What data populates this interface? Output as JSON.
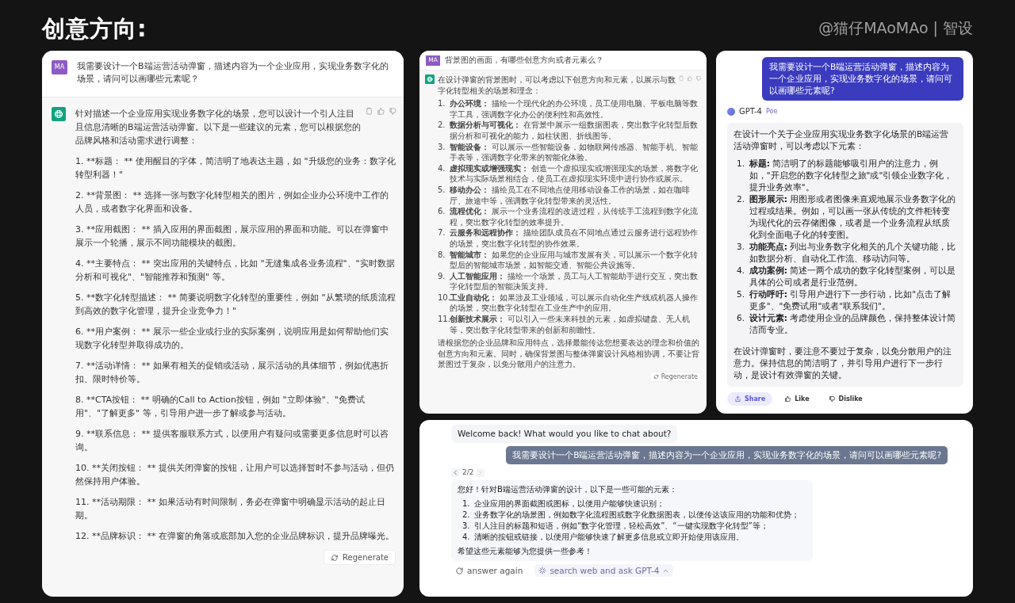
{
  "header": {
    "title": "创意方向:",
    "credit": "@猫仔MAoMAo | 智设"
  },
  "chatgpt_panel": {
    "user_avatar": "MA",
    "question": "我需要设计一个B端运营活动弹窗，描述内容为一个企业应用，实现业务数字化的场景，请问可以画哪些元素呢？",
    "answer_paragraphs": [
      "针对描述一个企业应用实现业务数字化的场景，您可以设计一个引人注目且信息清晰的B端运营活动弹窗。以下是一些建议的元素，您可以根据您的品牌风格和活动需求进行调整：",
      "1. **标题： ** 使用醒目的字体，简洁明了地表达主题，如 \"升级您的业务：数字化转型利器！\"",
      "2. **背景图： ** 选择一张与数字化转型相关的图片，例如企业办公环境中工作的人员，或者数字化界面和设备。",
      "3. **应用截图： ** 插入应用的界面截图，展示应用的界面和功能。可以在弹窗中展示一个轮播，展示不同功能模块的截图。",
      "4. **主要特点： ** 突出应用的关键特点，比如 \"无缝集成各业务流程\"、\"实时数据分析和可视化\"、\"智能推荐和预测\" 等。",
      "5. **数字化转型描述： ** 简要说明数字化转型的重要性，例如 \"从繁琐的纸质流程到高效的数字化管理，提升企业竞争力！\"",
      "6. **用户案例： ** 展示一些企业或行业的实际案例，说明应用是如何帮助他们实现数字化转型并取得成功的。",
      "7. **活动详情： ** 如果有相关的促销或活动，展示活动的具体细节，例如优惠折扣、限时特价等。",
      "8. **CTA按钮： ** 明确的Call to Action按钮，例如 \"立即体验\"、\"免费试用\"、\"了解更多\" 等，引导用户进一步了解或参与活动。",
      "9. **联系信息： ** 提供客服联系方式，以便用户有疑问或需要更多信息时可以咨询。",
      "10. **关闭按钮： ** 提供关闭弹窗的按钮，让用户可以选择暂时不参与活动，但仍然保持用户体验。",
      "11. **活动期限： ** 如果活动有时间限制，务必在弹窗中明确显示活动的起止日期。",
      "12. **品牌标识： ** 在弹窗的角落或底部加入您的企业品牌标识，提升品牌曝光。"
    ],
    "regenerate": "Regenerate"
  },
  "followup_panel": {
    "user_avatar": "MA",
    "question": "背景图的画面，有哪些创意方向或者元素么？",
    "intro": "在设计弹窗的背景图时，可以考虑以下创意方向和元素，以展示与数字化转型相关的场景和理念：",
    "items": [
      {
        "number": "1.",
        "title": "办公环境：",
        "text": "描绘一个现代化的办公环境，员工使用电脑、平板电脑等数字工具，强调数字化办公的便利性和高效性。"
      },
      {
        "number": "2.",
        "title": "数据分析与可视化：",
        "text": "在背景中展示一组数据图表，突出数字化转型后数据分析和可视化的能力，如柱状图、折线图等。"
      },
      {
        "number": "3.",
        "title": "智能设备：",
        "text": "可以展示一些智能设备，如物联网传感器、智能手机、智能手表等，强调数字化带来的智能化体验。"
      },
      {
        "number": "4.",
        "title": "虚拟现实或增强现实：",
        "text": "创造一个虚拟现实或增强现实的场景，将数字化技术与实际场景相结合，使员工在虚拟现实环境中进行协作或展示。"
      },
      {
        "number": "5.",
        "title": "移动办公：",
        "text": "描绘员工在不同地点使用移动设备工作的场景，如在咖啡厅、旅途中等，强调数字化转型带来的灵活性。"
      },
      {
        "number": "6.",
        "title": "流程优化：",
        "text": "展示一个业务流程的改进过程，从传统手工流程到数字化流程，突出数字化转型的效率提升。"
      },
      {
        "number": "7.",
        "title": "云服务和远程协作：",
        "text": "描绘团队成员在不同地点通过云服务进行远程协作的场景，突出数字化转型的协作效果。"
      },
      {
        "number": "8.",
        "title": "智能城市：",
        "text": "如果您的企业应用与城市发展有关，可以展示一个数字化转型后的智能城市场景，如智能交通、智能公共设施等。"
      },
      {
        "number": "9.",
        "title": "人工智能应用：",
        "text": "描绘一个场景，员工与人工智能助手进行交互，突出数字化转型后的智能决策支持。"
      },
      {
        "number": "10.",
        "title": "工业自动化：",
        "text": "如果涉及工业领域，可以展示自动化生产线或机器人操作的场景，突出数字化转型在工业生产中的应用。"
      },
      {
        "number": "11.",
        "title": "创新技术展示：",
        "text": "可以引入一些未来科技的元素，如虚拟键盘、无人机等，突出数字化转型带来的创新和前瞻性。"
      }
    ],
    "closing": "请根据您的企业品牌和应用特点，选择最能传达您想要表达的理念和价值的创意方向和元素。同时，确保背景图与整体弹窗设计风格相协调，不要让背景图过于复杂，以免分散用户的注意力。",
    "regenerate": "Regenerate"
  },
  "poe_panel": {
    "question": "我需要设计一个B端运营活动弹窗，描述内容为一个企业应用，实现业务数字化的场景，请问可以画哪些元素呢?",
    "bot_name": "GPT-4",
    "platform": "Poe",
    "intro": "在设计一个关于企业应用实现业务数字化场景的B端运营活动弹窗时，可以考虑以下元素：",
    "items": [
      {
        "number": "1.",
        "title": "标题:",
        "text": "简洁明了的标题能够吸引用户的注意力，例如，\"开启您的数字化转型之旅\"或\"引领企业数字化，提升业务效率\"。"
      },
      {
        "number": "2.",
        "title": "图形展示:",
        "text": "用图形或者图像来直观地展示业务数字化的过程或结果。例如，可以画一张从传统的文件柜转变为现代化的云存储图像，或者是一个业务流程从纸质化到全面电子化的转变图。"
      },
      {
        "number": "3.",
        "title": "功能亮点:",
        "text": "列出与业务数字化相关的几个关键功能，比如数据分析、自动化工作流、移动访问等。"
      },
      {
        "number": "4.",
        "title": "成功案例:",
        "text": "简述一两个成功的数字化转型案例，可以是具体的公司或者是行业范例。"
      },
      {
        "number": "5.",
        "title": "行动呼吁:",
        "text": "引导用户进行下一步行动，比如\"点击了解更多\"、\"免费试用\"或者\"联系我们\"。"
      },
      {
        "number": "6.",
        "title": "设计元素:",
        "text": "考虑使用企业的品牌颜色，保持整体设计简洁而专业。"
      }
    ],
    "closing": "在设计弹窗时，要注意不要过于复杂，以免分散用户的注意力。保持信息的简洁明了，并引导用户进行下一步行动，是设计有效弹窗的关键。",
    "actions": [
      {
        "kind": "share",
        "label": "Share",
        "selected": true
      },
      {
        "kind": "like",
        "label": "Like",
        "selected": false
      },
      {
        "kind": "dislike",
        "label": "Dislike",
        "selected": false
      }
    ]
  },
  "bottom_panel": {
    "welcome": "Welcome back! What would you like to chat about?",
    "question": "我需要设计一个B端运营活动弹窗，描述内容为一个企业应用，实现业务数字化的场景，请问可以画哪些元素呢?",
    "pager": "2/2",
    "intro": "您好！针对B端运营活动弹窗的设计，以下是一些可能的元素：",
    "items": [
      {
        "number": "1.",
        "text": "企业应用的界面截图或图标，以便用户能够快速识别；"
      },
      {
        "number": "2.",
        "text": "业务数字化的场景图，例如数字化流程图或数字化数据图表，以便传达该应用的功能和优势；"
      },
      {
        "number": "3.",
        "text": "引人注目的标题和短语，例如“数字化管理，轻松高效”、“一键实现数字化转型”等；"
      },
      {
        "number": "4.",
        "text": "清晰的按钮或链接，以便用户能够快速了解更多信息或立即开始使用该应用。"
      }
    ],
    "closing": "希望这些元素能够为您提供一些参考！",
    "actions": [
      {
        "kind": "retry",
        "label": "answer again"
      },
      {
        "kind": "search",
        "label": "search web and ask GPT-4"
      }
    ]
  }
}
